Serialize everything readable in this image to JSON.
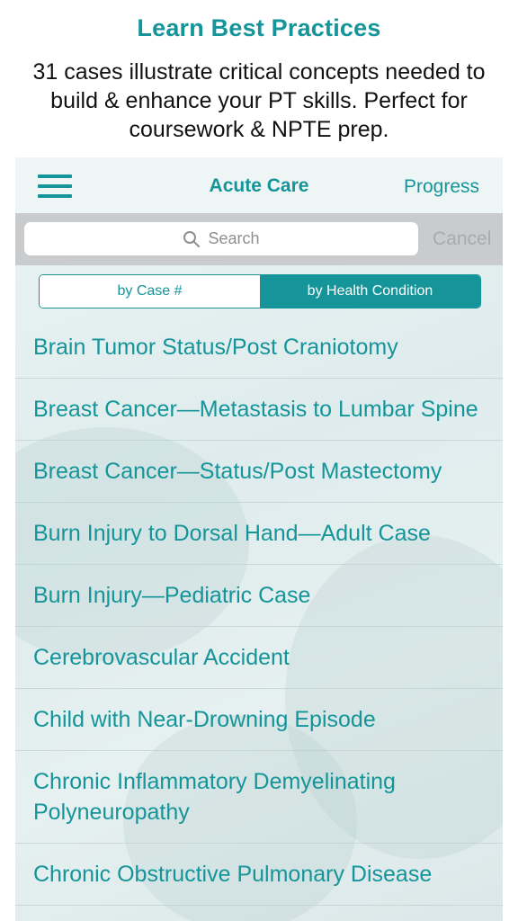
{
  "promo": {
    "title": "Learn Best Practices",
    "subtitle": "31 cases illustrate critical concepts needed to build & enhance your PT skills. Perfect for coursework & NPTE prep."
  },
  "navbar": {
    "menu_icon": "hamburger-menu-icon",
    "title": "Acute Care",
    "progress_label": "Progress"
  },
  "search": {
    "icon": "search-icon",
    "placeholder": "Search",
    "cancel_label": "Cancel"
  },
  "segmented": {
    "options": [
      "by Case #",
      "by Health Condition"
    ],
    "selected": "by Health Condition"
  },
  "cases": [
    "Brain Tumor Status/Post Craniotomy",
    "Breast Cancer—Metastasis to Lumbar Spine",
    "Breast Cancer—Status/Post Mastectomy",
    "Burn Injury to Dorsal Hand—Adult Case",
    "Burn Injury—Pediatric Case",
    "Cerebrovascular Accident",
    "Child with Near-Drowning Episode",
    "Chronic Inflammatory Demyelinating Polyneuropathy",
    "Chronic Obstructive Pulmonary Disease"
  ],
  "colors": {
    "accent": "#15959a",
    "searchbar_bg": "#c9cbcc",
    "cancel_text": "#a8aaac"
  }
}
